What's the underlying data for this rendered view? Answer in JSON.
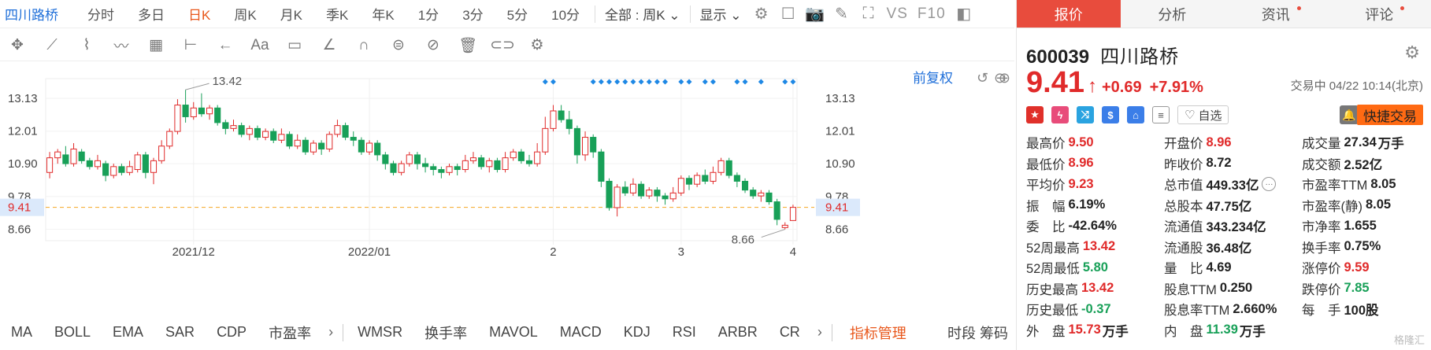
{
  "toolbar": {
    "stock_name": "四川路桥",
    "timeframes": [
      "分时",
      "多日",
      "日K",
      "周K",
      "月K",
      "季K",
      "年K",
      "1分",
      "3分",
      "5分",
      "10分"
    ],
    "active_timeframe": "日K",
    "filter_select": "全部 : 周K",
    "display_label": "显示",
    "vs_label": "VS",
    "f10_label": "F10"
  },
  "chart": {
    "adjust_label": "前复权",
    "max_label": "13.42",
    "min_label": "8.66",
    "current_price_label": "9.41",
    "y_ticks": [
      "13.13",
      "12.01",
      "10.90",
      "9.78",
      "8.66"
    ],
    "x_ticks": [
      "2021/12",
      "2022/01",
      "2",
      "3",
      "4"
    ]
  },
  "chart_data": {
    "type": "candlestick",
    "title": "",
    "ylim": [
      8.3,
      13.8
    ],
    "y_ticks": [
      13.13,
      12.01,
      10.9,
      9.78,
      8.66
    ],
    "x_tick_labels": [
      "2021/12",
      "2022/01",
      "2",
      "3",
      "4"
    ],
    "current_price": 9.41,
    "high_marker": 13.42,
    "low_marker": 8.66,
    "candles": [
      {
        "o": 10.6,
        "c": 11.1,
        "h": 11.3,
        "l": 10.4
      },
      {
        "o": 11.1,
        "c": 11.3,
        "h": 11.4,
        "l": 10.9
      },
      {
        "o": 11.2,
        "c": 10.9,
        "h": 11.5,
        "l": 10.8
      },
      {
        "o": 10.9,
        "c": 11.4,
        "h": 11.6,
        "l": 10.8
      },
      {
        "o": 11.3,
        "c": 11.0,
        "h": 11.4,
        "l": 10.9
      },
      {
        "o": 11.0,
        "c": 10.8,
        "h": 11.1,
        "l": 10.7
      },
      {
        "o": 10.8,
        "c": 11.0,
        "h": 11.2,
        "l": 10.7
      },
      {
        "o": 10.9,
        "c": 10.5,
        "h": 11.0,
        "l": 10.3
      },
      {
        "o": 10.5,
        "c": 10.8,
        "h": 10.9,
        "l": 10.4
      },
      {
        "o": 10.8,
        "c": 10.6,
        "h": 10.9,
        "l": 10.5
      },
      {
        "o": 10.6,
        "c": 10.8,
        "h": 11.0,
        "l": 10.5
      },
      {
        "o": 10.7,
        "c": 11.2,
        "h": 11.3,
        "l": 10.6
      },
      {
        "o": 11.2,
        "c": 10.6,
        "h": 11.3,
        "l": 10.4
      },
      {
        "o": 10.6,
        "c": 11.0,
        "h": 11.1,
        "l": 10.2
      },
      {
        "o": 11.0,
        "c": 11.5,
        "h": 11.7,
        "l": 10.9
      },
      {
        "o": 11.5,
        "c": 12.0,
        "h": 12.1,
        "l": 11.4
      },
      {
        "o": 12.0,
        "c": 12.9,
        "h": 13.1,
        "l": 11.9
      },
      {
        "o": 12.9,
        "c": 12.5,
        "h": 13.42,
        "l": 12.3
      },
      {
        "o": 12.5,
        "c": 12.8,
        "h": 13.0,
        "l": 12.4
      },
      {
        "o": 12.8,
        "c": 12.6,
        "h": 13.3,
        "l": 12.5
      },
      {
        "o": 12.6,
        "c": 12.8,
        "h": 12.9,
        "l": 12.4
      },
      {
        "o": 12.8,
        "c": 12.3,
        "h": 12.9,
        "l": 12.2
      },
      {
        "o": 12.3,
        "c": 12.1,
        "h": 12.4,
        "l": 11.9
      },
      {
        "o": 12.1,
        "c": 12.2,
        "h": 12.4,
        "l": 12.0
      },
      {
        "o": 12.2,
        "c": 11.9,
        "h": 12.3,
        "l": 11.8
      },
      {
        "o": 11.9,
        "c": 12.1,
        "h": 12.2,
        "l": 11.7
      },
      {
        "o": 12.1,
        "c": 11.8,
        "h": 12.2,
        "l": 11.7
      },
      {
        "o": 11.8,
        "c": 12.0,
        "h": 12.1,
        "l": 11.7
      },
      {
        "o": 12.0,
        "c": 11.7,
        "h": 12.1,
        "l": 11.6
      },
      {
        "o": 11.7,
        "c": 11.9,
        "h": 12.1,
        "l": 11.6
      },
      {
        "o": 11.9,
        "c": 11.5,
        "h": 12.0,
        "l": 11.4
      },
      {
        "o": 11.5,
        "c": 11.7,
        "h": 11.9,
        "l": 11.4
      },
      {
        "o": 11.7,
        "c": 11.3,
        "h": 11.8,
        "l": 11.2
      },
      {
        "o": 11.3,
        "c": 11.6,
        "h": 11.7,
        "l": 11.2
      },
      {
        "o": 11.6,
        "c": 11.4,
        "h": 11.7,
        "l": 11.2
      },
      {
        "o": 11.4,
        "c": 11.9,
        "h": 12.0,
        "l": 11.3
      },
      {
        "o": 11.9,
        "c": 12.2,
        "h": 12.4,
        "l": 11.8
      },
      {
        "o": 12.2,
        "c": 11.8,
        "h": 12.3,
        "l": 11.7
      },
      {
        "o": 11.8,
        "c": 11.7,
        "h": 12.0,
        "l": 11.5
      },
      {
        "o": 11.7,
        "c": 11.3,
        "h": 11.8,
        "l": 11.2
      },
      {
        "o": 11.3,
        "c": 11.6,
        "h": 11.7,
        "l": 11.2
      },
      {
        "o": 11.6,
        "c": 11.2,
        "h": 11.7,
        "l": 11.0
      },
      {
        "o": 11.2,
        "c": 10.9,
        "h": 11.3,
        "l": 10.7
      },
      {
        "o": 10.9,
        "c": 10.6,
        "h": 11.0,
        "l": 10.5
      },
      {
        "o": 10.6,
        "c": 10.9,
        "h": 11.0,
        "l": 10.5
      },
      {
        "o": 10.9,
        "c": 11.2,
        "h": 11.3,
        "l": 10.8
      },
      {
        "o": 11.2,
        "c": 10.9,
        "h": 11.3,
        "l": 10.7
      },
      {
        "o": 10.9,
        "c": 10.8,
        "h": 11.1,
        "l": 10.6
      },
      {
        "o": 10.8,
        "c": 10.7,
        "h": 10.9,
        "l": 10.5
      },
      {
        "o": 10.7,
        "c": 10.6,
        "h": 10.8,
        "l": 10.4
      },
      {
        "o": 10.6,
        "c": 10.8,
        "h": 10.9,
        "l": 10.5
      },
      {
        "o": 10.8,
        "c": 10.7,
        "h": 10.9,
        "l": 10.5
      },
      {
        "o": 10.7,
        "c": 11.0,
        "h": 11.2,
        "l": 10.6
      },
      {
        "o": 11.0,
        "c": 11.1,
        "h": 11.3,
        "l": 10.9
      },
      {
        "o": 11.1,
        "c": 10.8,
        "h": 11.2,
        "l": 10.7
      },
      {
        "o": 10.8,
        "c": 11.0,
        "h": 11.1,
        "l": 10.6
      },
      {
        "o": 11.0,
        "c": 10.7,
        "h": 11.1,
        "l": 10.6
      },
      {
        "o": 10.7,
        "c": 11.1,
        "h": 11.3,
        "l": 10.6
      },
      {
        "o": 11.1,
        "c": 11.3,
        "h": 11.4,
        "l": 11.0
      },
      {
        "o": 11.3,
        "c": 11.0,
        "h": 11.4,
        "l": 10.9
      },
      {
        "o": 11.0,
        "c": 10.9,
        "h": 11.2,
        "l": 10.8
      },
      {
        "o": 10.9,
        "c": 11.3,
        "h": 11.6,
        "l": 10.8
      },
      {
        "o": 11.3,
        "c": 12.1,
        "h": 12.5,
        "l": 11.2
      },
      {
        "o": 12.1,
        "c": 12.7,
        "h": 12.9,
        "l": 12.0
      },
      {
        "o": 12.7,
        "c": 12.4,
        "h": 12.9,
        "l": 12.3
      },
      {
        "o": 12.4,
        "c": 12.1,
        "h": 12.7,
        "l": 11.9
      },
      {
        "o": 12.1,
        "c": 11.2,
        "h": 12.2,
        "l": 10.9
      },
      {
        "o": 11.2,
        "c": 11.8,
        "h": 12.0,
        "l": 11.0
      },
      {
        "o": 11.8,
        "c": 11.3,
        "h": 11.9,
        "l": 11.1
      },
      {
        "o": 11.3,
        "c": 10.3,
        "h": 11.4,
        "l": 10.1
      },
      {
        "o": 10.3,
        "c": 9.4,
        "h": 10.4,
        "l": 9.3
      },
      {
        "o": 9.4,
        "c": 10.1,
        "h": 10.2,
        "l": 9.1
      },
      {
        "o": 10.1,
        "c": 9.9,
        "h": 10.3,
        "l": 9.8
      },
      {
        "o": 9.9,
        "c": 10.2,
        "h": 10.4,
        "l": 9.8
      },
      {
        "o": 10.2,
        "c": 9.8,
        "h": 10.3,
        "l": 9.7
      },
      {
        "o": 9.8,
        "c": 10.0,
        "h": 10.1,
        "l": 9.7
      },
      {
        "o": 10.0,
        "c": 9.8,
        "h": 10.1,
        "l": 9.6
      },
      {
        "o": 9.8,
        "c": 9.7,
        "h": 9.9,
        "l": 9.5
      },
      {
        "o": 9.7,
        "c": 9.9,
        "h": 10.1,
        "l": 9.6
      },
      {
        "o": 9.9,
        "c": 10.4,
        "h": 10.5,
        "l": 9.8
      },
      {
        "o": 10.4,
        "c": 10.2,
        "h": 10.5,
        "l": 10.0
      },
      {
        "o": 10.2,
        "c": 10.5,
        "h": 10.6,
        "l": 10.1
      },
      {
        "o": 10.5,
        "c": 10.3,
        "h": 10.7,
        "l": 10.2
      },
      {
        "o": 10.3,
        "c": 10.6,
        "h": 10.8,
        "l": 10.2
      },
      {
        "o": 10.6,
        "c": 11.0,
        "h": 11.1,
        "l": 10.5
      },
      {
        "o": 11.0,
        "c": 10.5,
        "h": 11.1,
        "l": 10.4
      },
      {
        "o": 10.5,
        "c": 10.3,
        "h": 10.6,
        "l": 10.1
      },
      {
        "o": 10.3,
        "c": 10.0,
        "h": 10.4,
        "l": 9.9
      },
      {
        "o": 10.0,
        "c": 9.8,
        "h": 10.1,
        "l": 9.7
      },
      {
        "o": 9.8,
        "c": 9.9,
        "h": 10.0,
        "l": 9.6
      },
      {
        "o": 9.9,
        "c": 9.6,
        "h": 10.0,
        "l": 9.5
      },
      {
        "o": 9.6,
        "c": 9.0,
        "h": 9.7,
        "l": 8.8
      },
      {
        "o": 8.72,
        "c": 8.8,
        "h": 8.9,
        "l": 8.66
      },
      {
        "o": 8.96,
        "c": 9.41,
        "h": 9.5,
        "l": 8.96
      }
    ],
    "signal_marker_candles": [
      62,
      63,
      68,
      69,
      70,
      71,
      72,
      73,
      74,
      75,
      76,
      77,
      79,
      80,
      82,
      83,
      86,
      87,
      89,
      92,
      93
    ]
  },
  "indicators": {
    "items": [
      "MA",
      "BOLL",
      "EMA",
      "SAR",
      "CDP",
      "市盈率"
    ],
    "items2": [
      "WMSR",
      "换手率",
      "MAVOL",
      "MACD",
      "KDJ",
      "RSI",
      "ARBR",
      "CR"
    ],
    "manage_label": "指标管理",
    "right_labels": [
      "时段",
      "筹码"
    ]
  },
  "panel": {
    "tabs": [
      "报价",
      "分析",
      "资讯",
      "评论"
    ],
    "code": "600039",
    "name": "四川路桥",
    "price": "9.41",
    "change": "+0.69",
    "change_pct": "+7.91%",
    "trade_time": "交易中 04/22 10:14(北京)",
    "fav_label": "自选",
    "quick_trade_label": "快捷交易",
    "stats": [
      {
        "label": "最高价",
        "value": "9.50",
        "tone": "red"
      },
      {
        "label": "开盘价",
        "value": "8.96",
        "tone": "red"
      },
      {
        "label": "成交量",
        "value": "27.34",
        "unit": "万手",
        "tone": "plain"
      },
      {
        "label": "最低价",
        "value": "8.96",
        "tone": "red"
      },
      {
        "label": "昨收价",
        "value": "8.72",
        "tone": "plain"
      },
      {
        "label": "成交额",
        "value": "2.52亿",
        "tone": "plain"
      },
      {
        "label": "平均价",
        "value": "9.23",
        "tone": "red"
      },
      {
        "label": "总市值",
        "value": "449.33亿",
        "tone": "plain",
        "more": true
      },
      {
        "label": "市盈率TTM",
        "value": "8.05",
        "tone": "plain"
      },
      {
        "label": "振　幅",
        "value": "6.19%",
        "tone": "plain"
      },
      {
        "label": "总股本",
        "value": "47.75亿",
        "tone": "plain"
      },
      {
        "label": "市盈率(静)",
        "value": "8.05",
        "tone": "plain"
      },
      {
        "label": "委　比",
        "value": "-42.64%",
        "tone": "plain"
      },
      {
        "label": "流通值",
        "value": "343.234亿",
        "tone": "plain"
      },
      {
        "label": "市净率",
        "value": "1.655",
        "tone": "plain"
      },
      {
        "label": "52周最高",
        "value": "13.42",
        "tone": "red"
      },
      {
        "label": "流通股",
        "value": "36.48亿",
        "tone": "plain"
      },
      {
        "label": "换手率",
        "value": "0.75%",
        "tone": "plain"
      },
      {
        "label": "52周最低",
        "value": "5.80",
        "tone": "green"
      },
      {
        "label": "量　比",
        "value": "4.69",
        "tone": "plain"
      },
      {
        "label": "涨停价",
        "value": "9.59",
        "tone": "red"
      },
      {
        "label": "历史最高",
        "value": "13.42",
        "tone": "red"
      },
      {
        "label": "股息TTM",
        "value": "0.250",
        "tone": "plain"
      },
      {
        "label": "跌停价",
        "value": "7.85",
        "tone": "green"
      },
      {
        "label": "历史最低",
        "value": "-0.37",
        "tone": "green"
      },
      {
        "label": "股息率TTM",
        "value": "2.660%",
        "tone": "plain"
      },
      {
        "label": "每　手",
        "value": "100股",
        "tone": "plain"
      },
      {
        "label": "外　盘",
        "value": "15.73",
        "unit": "万手",
        "tone": "red"
      },
      {
        "label": "内　盘",
        "value": "11.39",
        "unit": "万手",
        "tone": "green"
      }
    ],
    "watermark": "格隆汇"
  },
  "colors": {
    "up": "#e02a2a",
    "down": "#18a058",
    "accent": "#e8571b",
    "signal": "#1e88e5",
    "active_tab": "#e84c3d"
  }
}
